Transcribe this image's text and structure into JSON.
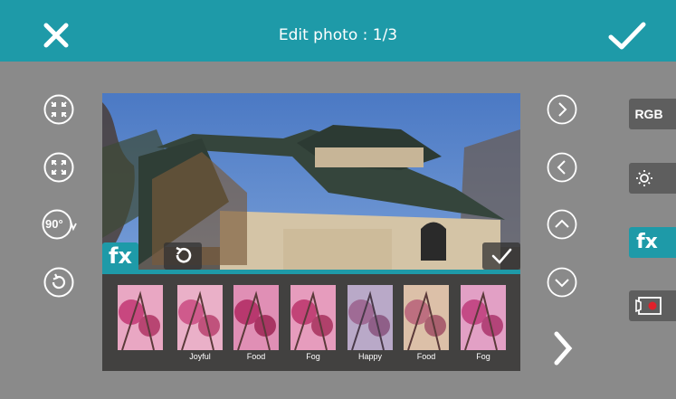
{
  "header": {
    "title": "Edit photo : 1/3"
  },
  "left_tools": [
    {
      "name": "shrink-icon"
    },
    {
      "name": "expand-icon"
    },
    {
      "name": "rotate-90-icon",
      "label": "90°"
    },
    {
      "name": "rotate-reset-icon"
    }
  ],
  "editor": {
    "fx_badge": "fx",
    "filters": [
      {
        "label": "",
        "tint": "#e9a7c3"
      },
      {
        "label": "Joyful",
        "tint": "#eab0c8"
      },
      {
        "label": "Food",
        "tint": "#e08fb5"
      },
      {
        "label": "Fog",
        "tint": "#e69cbd"
      },
      {
        "label": "Happy",
        "tint": "#b9a9c8"
      },
      {
        "label": "Food",
        "tint": "#dcc0a8"
      },
      {
        "label": "Fog",
        "tint": "#e2a0c5"
      }
    ]
  },
  "right_tools": {
    "rgb_label": "RGB",
    "fx_label": "fx"
  },
  "colors": {
    "accent": "#1e9aa8",
    "background": "#8a8a8a"
  }
}
